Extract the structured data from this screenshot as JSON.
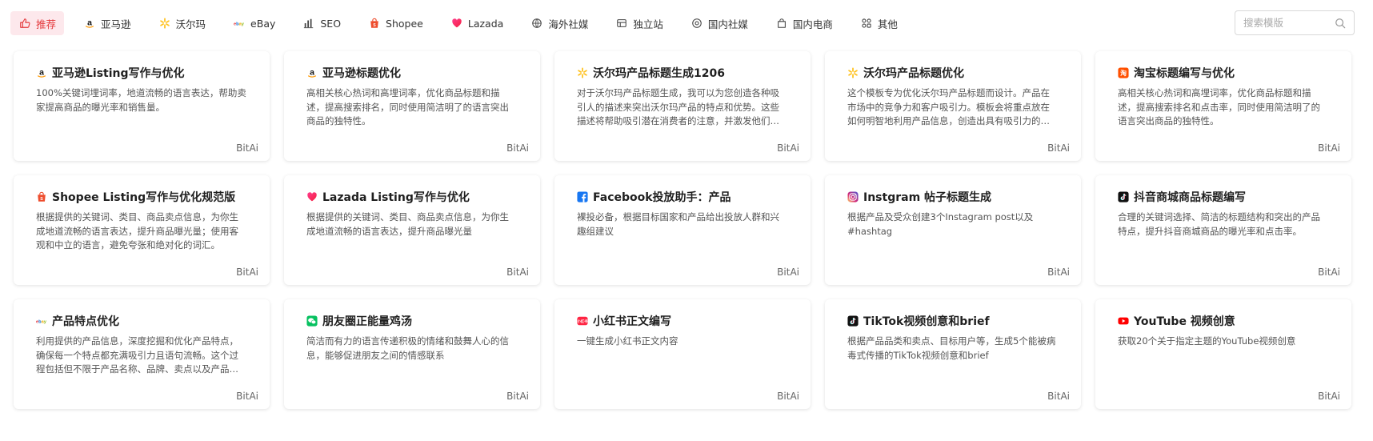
{
  "tabs": [
    {
      "label": "推荐",
      "icon": "thumbs-up-icon",
      "active": true
    },
    {
      "label": "亚马逊",
      "icon": "amazon-icon"
    },
    {
      "label": "沃尔玛",
      "icon": "walmart-icon"
    },
    {
      "label": "eBay",
      "icon": "ebay-icon"
    },
    {
      "label": "SEO",
      "icon": "bar-chart-icon"
    },
    {
      "label": "Shopee",
      "icon": "shopee-icon"
    },
    {
      "label": "Lazada",
      "icon": "lazada-icon"
    },
    {
      "label": "海外社媒",
      "icon": "global-chat-icon"
    },
    {
      "label": "独立站",
      "icon": "storefront-icon"
    },
    {
      "label": "国内社媒",
      "icon": "circle-chat-icon"
    },
    {
      "label": "国内电商",
      "icon": "shopping-bag-icon"
    },
    {
      "label": "其他",
      "icon": "grid-icon"
    }
  ],
  "search": {
    "placeholder": "搜索模版"
  },
  "cards": [
    {
      "icon": "amazon-icon",
      "title": "亚马逊Listing写作与优化",
      "desc": "100%关键词埋词率，地道流畅的语言表达，帮助卖家提高商品的曝光率和销售量。",
      "author": "BitAi"
    },
    {
      "icon": "amazon-icon",
      "title": "亚马逊标题优化",
      "desc": "高相关核心热词和高埋词率，优化商品标题和描述，提高搜索排名，同时使用简洁明了的语言突出商品的独特性。",
      "author": "BitAi"
    },
    {
      "icon": "walmart-icon",
      "title": "沃尔玛产品标题生成1206",
      "desc": "对于沃尔玛产品标题生成，我可以为您创造各种吸引人的描述来突出沃尔玛产品的特点和优势。这些描述将帮助吸引潜在消费者的注意，并激发他们的购买欲望。",
      "author": "BitAi"
    },
    {
      "icon": "walmart-icon",
      "title": "沃尔玛产品标题优化",
      "desc": "这个模板专为优化沃尔玛产品标题而设计。产品在市场中的竞争力和客户吸引力。模板会将重点放在如何明智地利用产品信息，创造出具有吸引力的标题。",
      "author": "BitAi"
    },
    {
      "icon": "taobao-icon",
      "title": "淘宝标题编写与优化",
      "desc": "高相关核心热词和高埋词率，优化商品标题和描述，提高搜索排名和点击率，同时使用简洁明了的语言突出商品的独特性。",
      "author": "BitAi"
    },
    {
      "icon": "shopee-icon",
      "title": "Shopee Listing写作与优化规范版",
      "desc": "根据提供的关键词、类目、商品卖点信息，为你生成地道流畅的语言表达，提升商品曝光量；使用客观和中立的语言，避免夸张和绝对化的词汇。",
      "author": "BitAi"
    },
    {
      "icon": "lazada-icon",
      "title": "Lazada Listing写作与优化",
      "desc": "根据提供的关键词、类目、商品卖点信息，为你生成地道流畅的语言表达，提升商品曝光量",
      "author": "BitAi"
    },
    {
      "icon": "facebook-icon",
      "title": "Facebook投放助手：产品",
      "desc": "裸投必备，根据目标国家和产品给出投放人群和兴趣组建议",
      "author": "BitAi"
    },
    {
      "icon": "instagram-icon",
      "title": "Instgram 帖子标题生成",
      "desc": "根据产品及受众创建3个Instagram post以及#hashtag",
      "author": "BitAi"
    },
    {
      "icon": "tiktok-icon",
      "title": "抖音商城商品标题编写",
      "desc": "合理的关键词选择、简洁的标题结构和突出的产品特点，提升抖音商城商品的曝光率和点击率。",
      "author": "BitAi"
    },
    {
      "icon": "ebay-icon",
      "title": "产品特点优化",
      "desc": "利用提供的产品信息，深度挖掘和优化产品特点，确保每一个特点都充满吸引力且语句流畅。这个过程包括但不限于产品名称、品牌、卖点以及产品信息。",
      "author": "BitAi"
    },
    {
      "icon": "wechat-icon",
      "title": "朋友圈正能量鸡汤",
      "desc": "简洁而有力的语言传递积极的情绪和鼓舞人心的信息，能够促进朋友之间的情感联系",
      "author": "BitAi"
    },
    {
      "icon": "xiaohongshu-icon",
      "title": "小红书正文编写",
      "desc": "一键生成小红书正文内容",
      "author": "BitAi"
    },
    {
      "icon": "tiktok-icon",
      "title": "TikTok视频创意和brief",
      "desc": "根据产品品类和卖点、目标用户等，生成5个能被病毒式传播的TikTok视频创意和brief",
      "author": "BitAi"
    },
    {
      "icon": "youtube-icon",
      "title": "YouTube 视频创意",
      "desc": "获取20个关于指定主题的YouTube视频创意",
      "author": "BitAi"
    }
  ],
  "colors": {
    "accent": "#e4393c",
    "active_bg": "#fde8ec"
  }
}
